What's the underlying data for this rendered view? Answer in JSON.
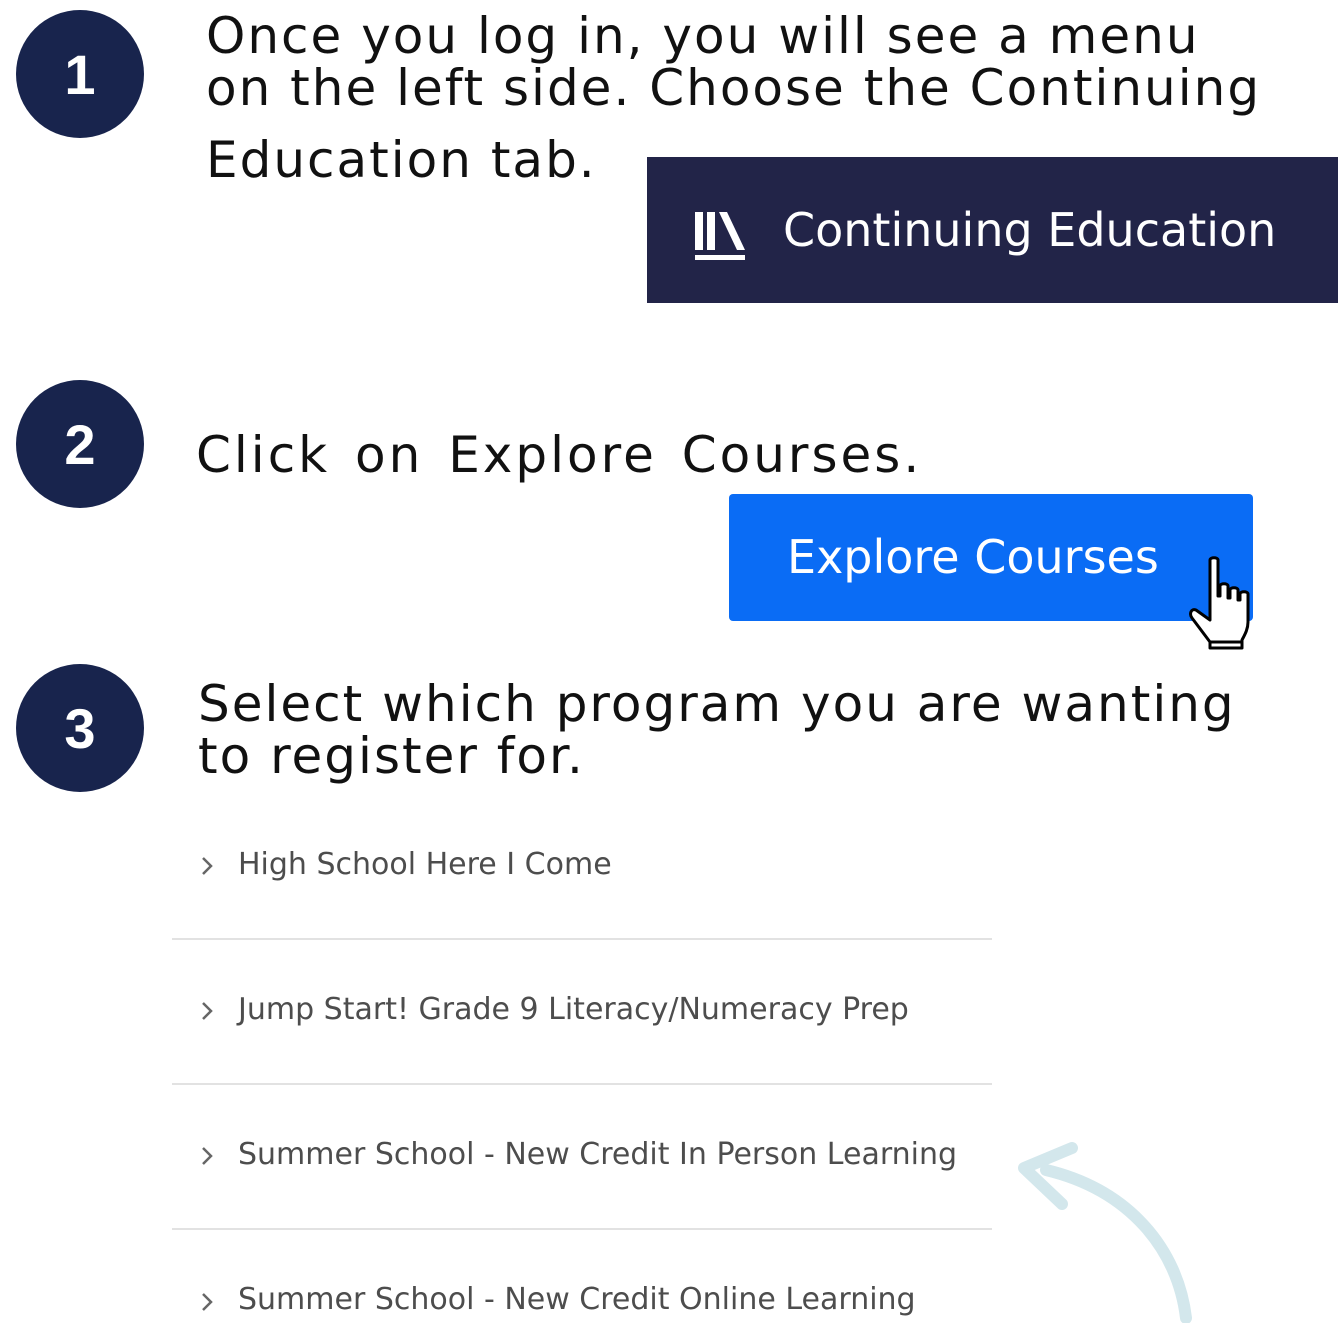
{
  "colors": {
    "step_circle": "#18244d",
    "tab_background": "#222448",
    "button_background": "#0a6cf5",
    "arrow": "#d3e7ec"
  },
  "steps": [
    {
      "number": "1",
      "lines": [
        "Once you log in, you will see a menu",
        "on the left side. Choose the Continuing",
        "Education tab."
      ]
    },
    {
      "number": "2",
      "lines": [
        "Click on Explore Courses."
      ]
    },
    {
      "number": "3",
      "lines": [
        "Select which program you are wanting",
        "to register for."
      ]
    }
  ],
  "continuing_education_tab": {
    "label": "Continuing Education",
    "icon": "library-books-icon"
  },
  "explore_button": {
    "label": "Explore Courses",
    "cursor": "hand-pointer-cursor"
  },
  "programs": [
    {
      "label": "High School Here I Come",
      "icon": "chevron-right-icon"
    },
    {
      "label": "Jump Start! Grade 9 Literacy/Numeracy Prep",
      "icon": "chevron-right-icon"
    },
    {
      "label": "Summer School - New Credit In Person Learning",
      "icon": "chevron-right-icon"
    },
    {
      "label": "Summer School - New Credit Online Learning",
      "icon": "chevron-right-icon"
    }
  ],
  "decoration": {
    "arrow_icon": "curved-arrow-icon"
  }
}
